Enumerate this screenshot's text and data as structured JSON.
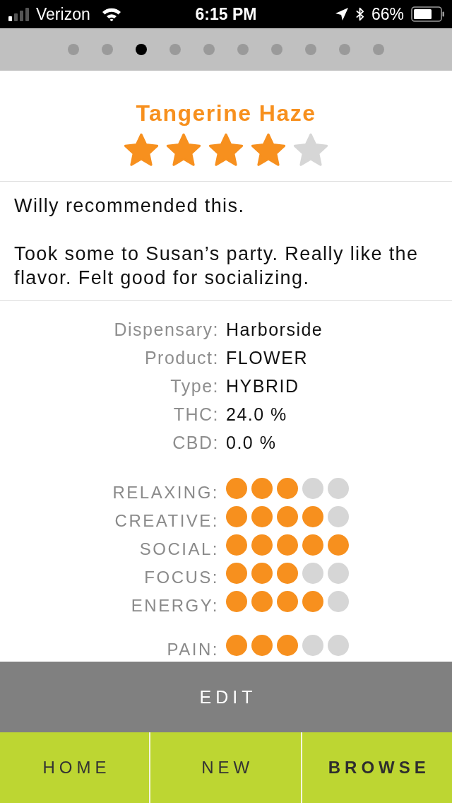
{
  "status_bar": {
    "carrier": "Verizon",
    "time": "6:15 PM",
    "battery": "66%"
  },
  "pager": [
    {
      "selected": false
    },
    {
      "selected": false
    },
    {
      "selected": true
    },
    {
      "selected": false
    },
    {
      "selected": false
    },
    {
      "selected": false
    },
    {
      "selected": false
    },
    {
      "selected": false
    },
    {
      "selected": false
    },
    {
      "selected": false
    }
  ],
  "strain": {
    "name": "Tangerine Haze",
    "stars": 4
  },
  "notes": [
    "Willy recommended this.",
    "Took some to Susan’s party. Really like the flavor. Felt good for socializing."
  ],
  "details": [
    {
      "label": "Dispensary:",
      "value": "Harborside"
    },
    {
      "label": "Product:",
      "value": "FLOWER"
    },
    {
      "label": "Type:",
      "value": "HYBRID"
    },
    {
      "label": "THC:",
      "value": "24.0 %"
    },
    {
      "label": "CBD:",
      "value": "0.0 %"
    }
  ],
  "effects": [
    {
      "label": "RELAXING:",
      "stars": 3
    },
    {
      "label": "CREATIVE:",
      "stars": 4
    },
    {
      "label": "SOCIAL:",
      "stars": 5
    },
    {
      "label": "FOCUS:",
      "stars": 3
    },
    {
      "label": "ENERGY:",
      "stars": 4
    }
  ],
  "medical": [
    {
      "label": "PAIN:",
      "stars": 3
    }
  ],
  "edit_button": "EDIT",
  "tabs": [
    {
      "label": "HOME",
      "selected": false
    },
    {
      "label": "NEW",
      "selected": false
    },
    {
      "label": "BROWSE",
      "selected": true
    }
  ]
}
